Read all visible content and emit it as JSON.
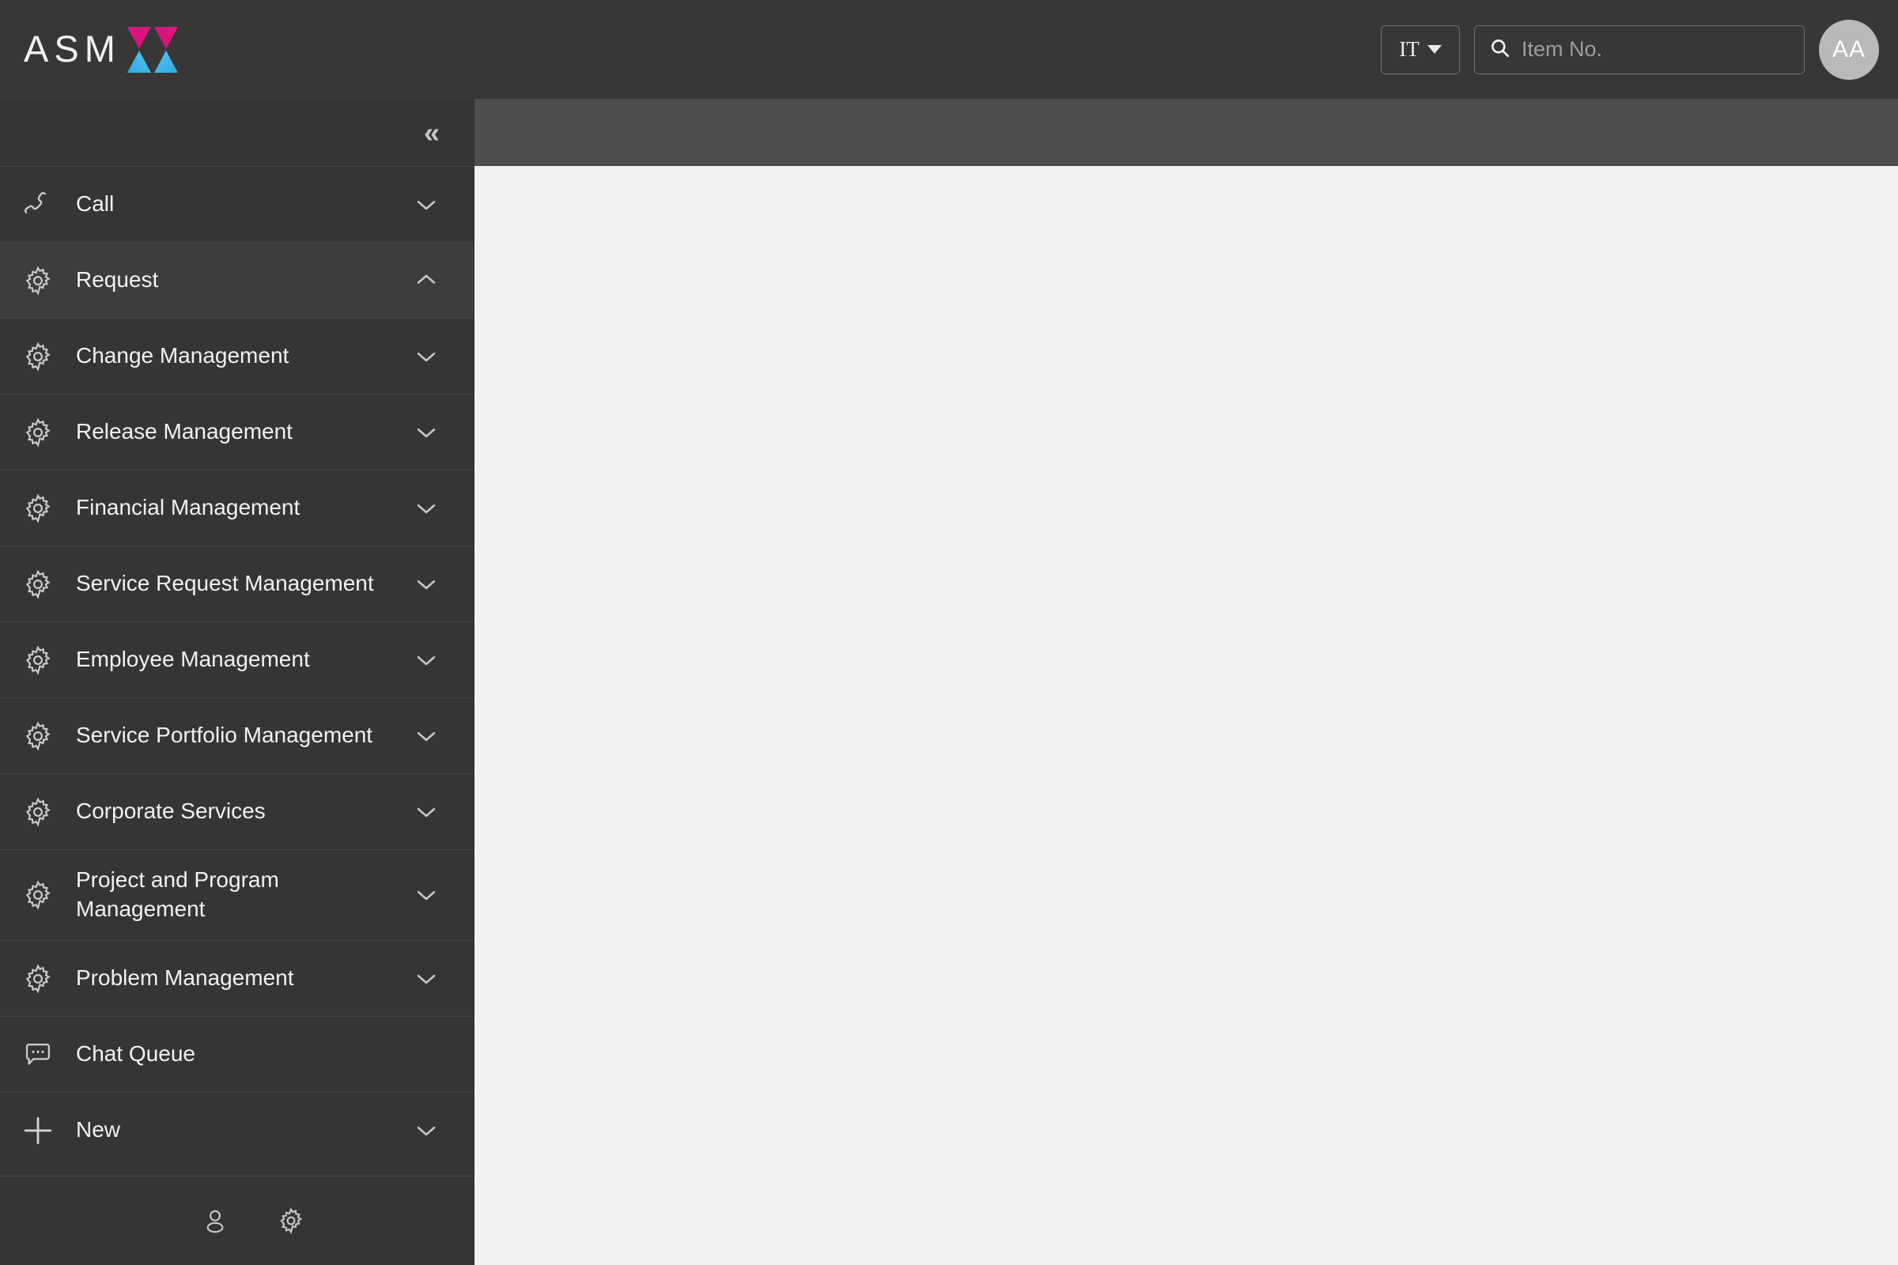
{
  "header": {
    "logo_text": "ASM",
    "logo_mark_icon": "asmx-x-mark-icon",
    "logo_colors": {
      "pink": "#e6007e",
      "pink_dark": "#c2186c",
      "blue": "#29a9e1",
      "blue_light": "#5bc5f2"
    },
    "language": {
      "value": "IT",
      "caret_icon": "caret-down-icon"
    },
    "search": {
      "placeholder": "Item No.",
      "value": "",
      "icon": "search-icon"
    },
    "avatar": {
      "initials": "AA"
    },
    "background": "#373737"
  },
  "sidebar": {
    "background": "#353535",
    "collapse": {
      "icon": "double-chevron-left-icon",
      "glyph": "«"
    },
    "items": [
      {
        "label": "Call",
        "icon": "phone-icon",
        "chevron": "down",
        "expanded": false,
        "highlight": false,
        "tall": false
      },
      {
        "label": "Request",
        "icon": "gear-icon",
        "chevron": "up",
        "expanded": true,
        "highlight": true,
        "tall": false
      },
      {
        "label": "Change Management",
        "icon": "gear-icon",
        "chevron": "down",
        "expanded": false,
        "highlight": false,
        "tall": false
      },
      {
        "label": "Release Management",
        "icon": "gear-icon",
        "chevron": "down",
        "expanded": false,
        "highlight": false,
        "tall": false
      },
      {
        "label": "Financial Management",
        "icon": "gear-icon",
        "chevron": "down",
        "expanded": false,
        "highlight": false,
        "tall": false
      },
      {
        "label": "Service Request Management",
        "icon": "gear-icon",
        "chevron": "down",
        "expanded": false,
        "highlight": false,
        "tall": false
      },
      {
        "label": "Employee Management",
        "icon": "gear-icon",
        "chevron": "down",
        "expanded": false,
        "highlight": false,
        "tall": false
      },
      {
        "label": "Service Portfolio Management",
        "icon": "gear-icon",
        "chevron": "down",
        "expanded": false,
        "highlight": false,
        "tall": false
      },
      {
        "label": "Corporate Services",
        "icon": "gear-icon",
        "chevron": "down",
        "expanded": false,
        "highlight": false,
        "tall": false
      },
      {
        "label": "Project and Program Management",
        "icon": "gear-icon",
        "chevron": "down",
        "expanded": false,
        "highlight": false,
        "tall": true
      },
      {
        "label": "Problem Management",
        "icon": "gear-icon",
        "chevron": "down",
        "expanded": false,
        "highlight": false,
        "tall": false
      },
      {
        "label": "Chat Queue",
        "icon": "chat-bubble-icon",
        "chevron": "none",
        "expanded": false,
        "highlight": false,
        "tall": false
      },
      {
        "label": "New",
        "icon": "plus-icon",
        "chevron": "down",
        "expanded": false,
        "highlight": false,
        "tall": false
      }
    ],
    "footer": [
      {
        "icon": "user-icon",
        "name": "profile-button"
      },
      {
        "icon": "gear-icon",
        "name": "settings-button"
      }
    ]
  },
  "main": {
    "toolbar_background": "#4e4e4e",
    "canvas_background": "#f2f2f2",
    "content": ""
  }
}
